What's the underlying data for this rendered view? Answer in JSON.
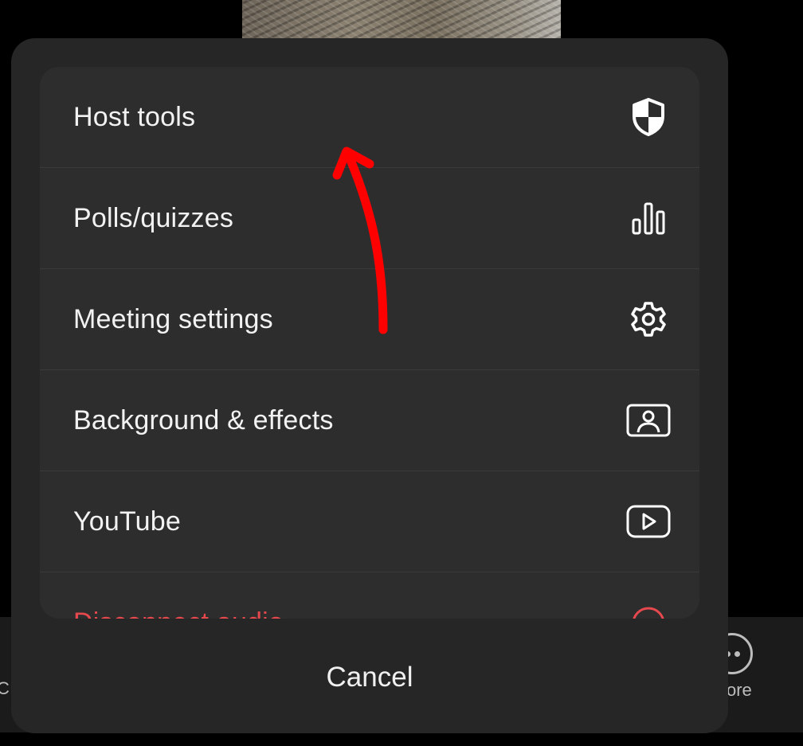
{
  "menu": {
    "items": [
      {
        "label": "Host tools",
        "icon": "shield-icon"
      },
      {
        "label": "Polls/quizzes",
        "icon": "bar-chart-icon"
      },
      {
        "label": "Meeting settings",
        "icon": "gear-icon"
      },
      {
        "label": "Background & effects",
        "icon": "person-frame-icon"
      },
      {
        "label": "YouTube",
        "icon": "play-icon"
      },
      {
        "label": "Disconnect audio",
        "icon": "circle-icon"
      }
    ]
  },
  "cancel_label": "Cancel",
  "bottom_bar": {
    "left_label": "C",
    "more_label": "ore"
  },
  "colors": {
    "sheet_bg": "#262626",
    "card_bg": "#2d2d2d",
    "danger": "#e5484d",
    "annotation": "#ff0000"
  }
}
